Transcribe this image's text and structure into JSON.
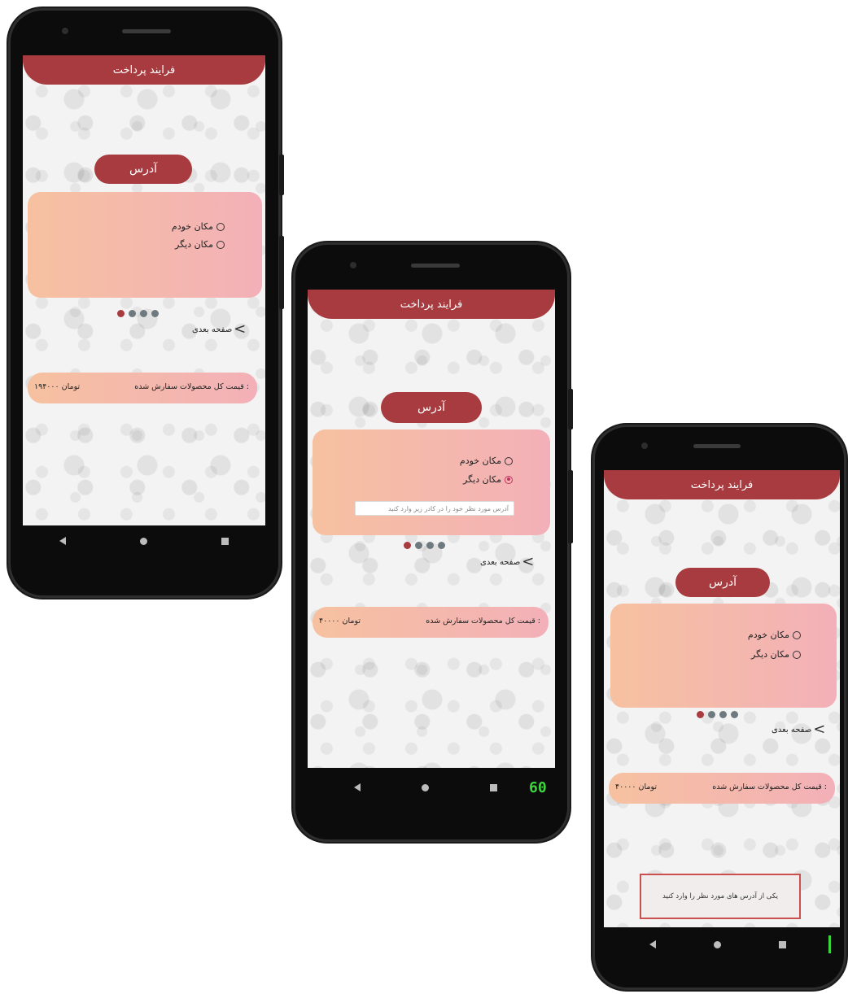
{
  "app": {
    "title": "فرایند پرداخت",
    "address_button": "آدرس",
    "option_mine": "مکان خودم",
    "option_other": "مکان دیگر",
    "address_placeholder": "آدرس مورد نظر خود را در کادر زیر وارد کنید",
    "next_label": "صفحه بعدی",
    "total_label": "قیمت کل محصولات سفارش شده :"
  },
  "screens": [
    {
      "total_price": "۱۹۴۰۰۰ تومان",
      "selected_option": "none",
      "active_dot": 0
    },
    {
      "total_price": "۴۰۰۰۰ تومان",
      "selected_option": "other",
      "active_dot": 0
    },
    {
      "total_price": "۴۰۰۰۰ تومان",
      "selected_option": "none",
      "active_dot": 0,
      "toast": "یکی از آدرس های مورد نظر را وارد کنید"
    }
  ],
  "fps_counter": "60",
  "colors": {
    "accent": "#a83b3f",
    "card_gradient_start": "#f6c1a0",
    "card_gradient_end": "#f3b0b8",
    "radio_selected": "#c0335e",
    "fps": "#3dd43d"
  },
  "icons": [
    "radio-icon",
    "chevron-left-icon",
    "nav-back-icon",
    "nav-home-icon",
    "nav-recents-icon"
  ]
}
